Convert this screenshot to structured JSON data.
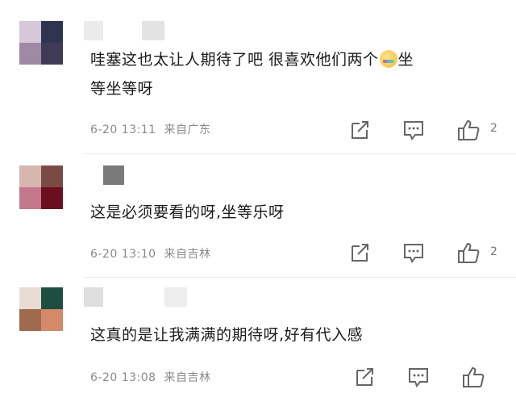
{
  "comments": [
    {
      "text_lines": [
        "哇塞这也太让人期待了吧 很喜欢他们两个",
        "坐",
        "等坐等呀"
      ],
      "time": "6-20 13:11",
      "location": "来自广东",
      "likes": "2",
      "avatar_colors": [
        "#d8c6d9",
        "#2f3550",
        "#9f8aa6",
        "#3f3a55"
      ],
      "name_colors": [
        "#ebebeb",
        "#e3e3e3"
      ]
    },
    {
      "text": "这是必须要看的呀,坐等乐呀",
      "time": "6-20 13:10",
      "location": "来自吉林",
      "likes": "2",
      "avatar_colors": [
        "#d7b6b0",
        "#7a4b45",
        "#c3778a",
        "#6b0f1e"
      ],
      "name_colors": [
        "#7a7a7a"
      ]
    },
    {
      "text": "这真的是让我满满的期待呀,好有代入感",
      "time": "6-20 13:08",
      "location": "来自吉林",
      "likes": "",
      "avatar_colors": [
        "#e9dcd3",
        "#1e4d41",
        "#a06a4f",
        "#d28a6a"
      ],
      "name_colors": [
        "#dedede",
        "#ededed"
      ]
    }
  ],
  "icons": {
    "share": "share-icon",
    "reply": "comment-icon",
    "like": "thumbs-up-icon"
  }
}
